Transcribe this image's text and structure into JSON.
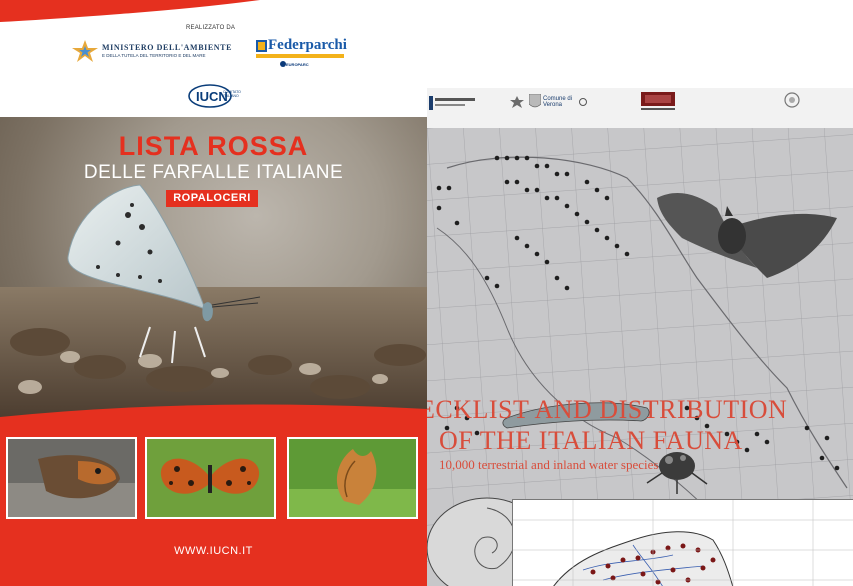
{
  "left_cover": {
    "realizzato": "REALIZZATO DA",
    "ministero_title": "MINISTERO DELL'AMBIENTE",
    "ministero_subtitle": "E DELLA TUTELA DEL TERRITORIO E DEL MARE",
    "federparchi": "Federparchi",
    "europarc": "EUROPARC",
    "iucn": "IUCN",
    "iucn_sub": "COMITATO ITALIANO",
    "title_line1": "LISTA ROSSA",
    "title_line2": "DELLE FARFALLE ITALIANE",
    "tag": "ROPALOCERI",
    "url": "WWW.IUCN.IT",
    "colors": {
      "red": "#e5301f",
      "blue": "#0a3d7a"
    }
  },
  "right_cover": {
    "title_line1": "ECKLIST AND DISTRIBUTION",
    "title_line2": "OF THE ITALIAN FAUNA",
    "subtitle": "10,000 terrestrial and inland water species",
    "logo_label_1": "Comune di Verona",
    "colors": {
      "title": "#d84d3b",
      "background": "#c7c7c9"
    }
  }
}
